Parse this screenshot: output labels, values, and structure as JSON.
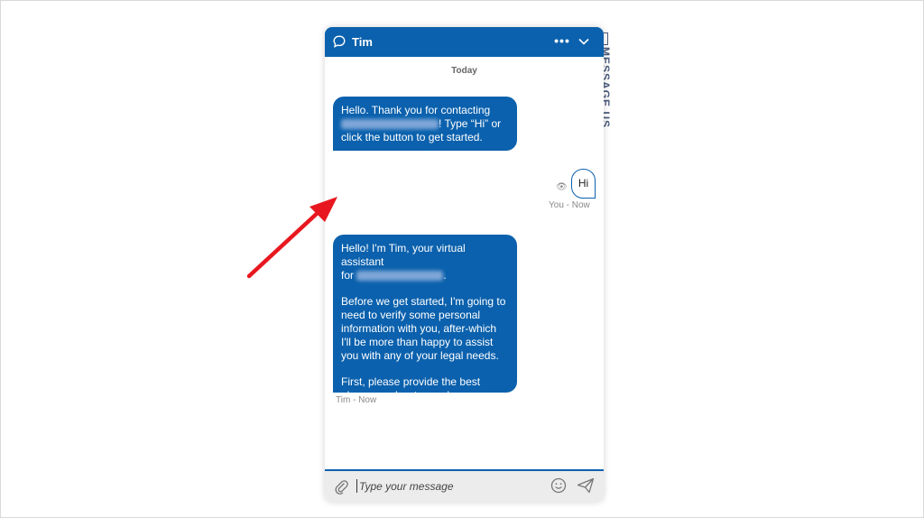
{
  "background": {
    "bleed_text": "MESSAGE US"
  },
  "header": {
    "title": "Tim",
    "more_label": "•••",
    "color": "#0b61ad"
  },
  "chat": {
    "date_label": "Today",
    "messages": [
      {
        "sender": "bot",
        "line1": "Hello. Thank you for contacting",
        "line2_suffix": "! Type “Hi” or",
        "line3": "click the button to get started."
      },
      {
        "sender": "user",
        "text": "Hi",
        "meta": "You - Now"
      },
      {
        "sender": "bot",
        "p1_line1": "Hello! I'm Tim, your virtual assistant",
        "p1_line2_prefix": "for ",
        "p1_line2_suffix": ".",
        "p2": "Before we get started, I'm going to need to verify some personal information with you, after-which I'll be more than happy to assist you with any of your legal needs.",
        "p3": "First, please provide the best phone number to reach you.",
        "meta": "Tim - Now"
      }
    ]
  },
  "composer": {
    "placeholder": "Type your message"
  },
  "icons": {
    "chat": "chat-bubble-icon",
    "more": "more-horizontal-icon",
    "collapse": "chevron-down-icon",
    "attach": "paperclip-icon",
    "emoji": "smiley-icon",
    "send": "send-icon",
    "read": "read-receipt-icon"
  },
  "annotation": {
    "arrow_color": "#e8171f"
  }
}
